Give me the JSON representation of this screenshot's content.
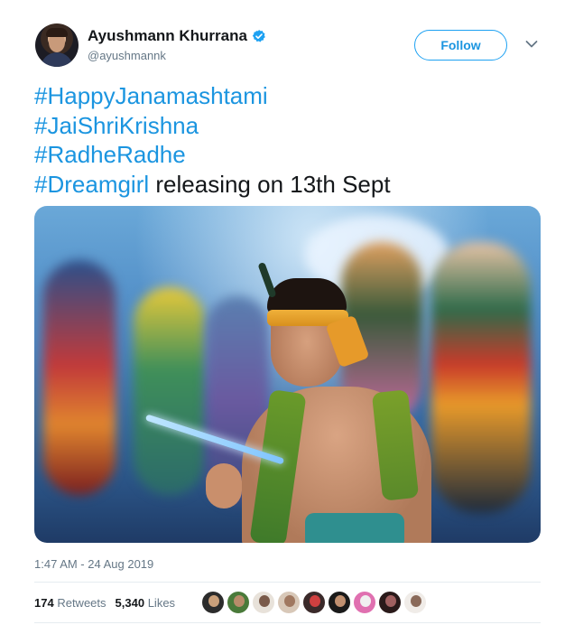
{
  "author": {
    "name": "Ayushmann Khurrana",
    "handle": "@ayushmannk",
    "verified": true
  },
  "follow_button": {
    "label": "Follow"
  },
  "tweet": {
    "lines": [
      {
        "hashtag": "#HappyJanamashtami",
        "rest": ""
      },
      {
        "hashtag": "#JaiShriKrishna",
        "rest": ""
      },
      {
        "hashtag": "#RadheRadhe",
        "rest": ""
      },
      {
        "hashtag": "#Dreamgirl",
        "rest": " releasing on 13th Sept"
      }
    ]
  },
  "timestamp": "1:47 AM - 24 Aug 2019",
  "stats": {
    "retweets_count": "174",
    "retweets_label": "Retweets",
    "likes_count": "5,340",
    "likes_label": "Likes"
  },
  "colors": {
    "accent": "#1da1f2",
    "hashtag": "#1b95e0",
    "muted": "#657786",
    "text": "#14171a"
  },
  "likers": [
    {
      "color": "#2c2c2c",
      "face": "#caa07a"
    },
    {
      "color": "#4a7a3a",
      "face": "#b98c6a"
    },
    {
      "color": "#e8e2da",
      "face": "#7a5a4a"
    },
    {
      "color": "#d8c8b8",
      "face": "#a07860"
    },
    {
      "color": "#3a2a2a",
      "face": "#d04040"
    },
    {
      "color": "#1a1a1a",
      "face": "#c09070"
    },
    {
      "color": "#e070b0",
      "face": "#f0f0f0"
    },
    {
      "color": "#2a1a1a",
      "face": "#a06060"
    },
    {
      "color": "#f0ece8",
      "face": "#8a6a5a"
    }
  ]
}
